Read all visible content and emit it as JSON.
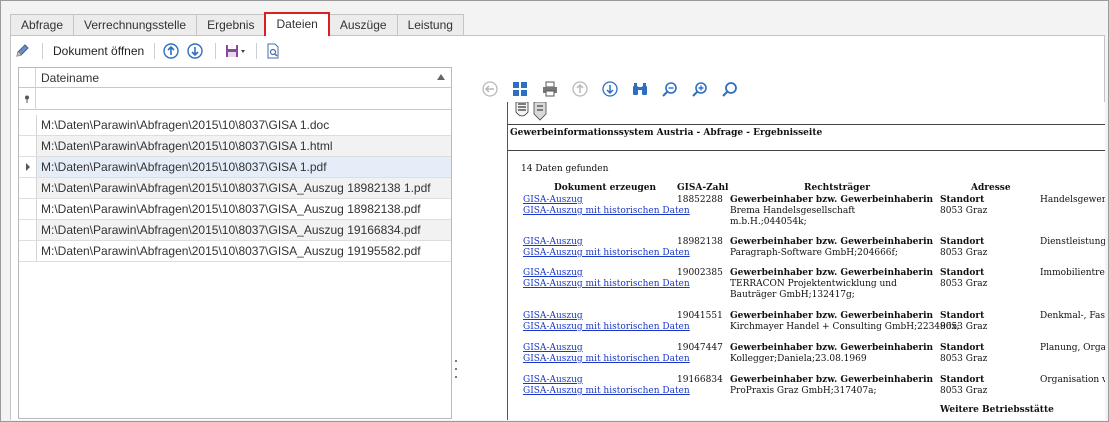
{
  "tabs": [
    {
      "label": "Abfrage"
    },
    {
      "label": "Verrechnungsstelle"
    },
    {
      "label": "Ergebnis"
    },
    {
      "label": "Dateien",
      "active": true
    },
    {
      "label": "Auszüge"
    },
    {
      "label": "Leistung"
    }
  ],
  "toolbar": {
    "edit_icon": "pencil-icon",
    "open_label": "Dokument öffnen",
    "up_icon": "arrow-up-circle-icon",
    "down_icon": "arrow-down-circle-icon",
    "save_icon": "save-dropdown-icon",
    "preview_icon": "page-search-icon"
  },
  "grid": {
    "column_header": "Dateiname",
    "filter_icon": "filter-pin-icon",
    "selected_index": 2,
    "rows": [
      "M:\\Daten\\Parawin\\Abfragen\\2015\\10\\8037\\GISA 1.doc",
      "M:\\Daten\\Parawin\\Abfragen\\2015\\10\\8037\\GISA 1.html",
      "M:\\Daten\\Parawin\\Abfragen\\2015\\10\\8037\\GISA 1.pdf",
      "M:\\Daten\\Parawin\\Abfragen\\2015\\10\\8037\\GISA_Auszug 18982138 1.pdf",
      "M:\\Daten\\Parawin\\Abfragen\\2015\\10\\8037\\GISA_Auszug 18982138.pdf",
      "M:\\Daten\\Parawin\\Abfragen\\2015\\10\\8037\\GISA_Auszug 19166834.pdf",
      "M:\\Daten\\Parawin\\Abfragen\\2015\\10\\8037\\GISA_Auszug 19195582.pdf"
    ]
  },
  "viewer_toolbar": [
    "back-circle-icon",
    "windows-icon",
    "printer-icon",
    "arrow-up-circle-icon",
    "arrow-down-circle-icon",
    "binoculars-icon",
    "zoom-out-icon",
    "zoom-in-icon",
    "search-icon"
  ],
  "document": {
    "title": "Gewerbeinformationssystem Austria - Abfrage - Ergebnisseite",
    "found": "14 Daten gefunden",
    "headers": {
      "doc": "Dokument erzeugen",
      "gisa": "GISA-Zahl",
      "rechtstraeger": "Rechtsträger",
      "adresse": "Adresse"
    },
    "link1": "GISA-Auszug",
    "link2": "GISA-Auszug mit historischen Daten",
    "entries": [
      {
        "gisa": "18852288",
        "role": "Gewerbeinhaber bzw. Gewerbeinhaberin",
        "name": [
          "Brema Handelsgesellschaft",
          "m.b.H.;044054k;"
        ],
        "addr1": "Standort",
        "addr2": "8053 Graz",
        "extra": "Handelsgewerbe"
      },
      {
        "gisa": "18982138",
        "role": "Gewerbeinhaber bzw. Gewerbeinhaberin",
        "name": [
          "Paragraph-Software GmbH;204666f;"
        ],
        "addr1": "Standort",
        "addr2": "8053 Graz",
        "extra": "Dienstleistungen"
      },
      {
        "gisa": "19002385",
        "role": "Gewerbeinhaber bzw. Gewerbeinhaberin",
        "name": [
          "TERRACON Projektentwicklung und",
          "Bauträger GmbH;132417g;"
        ],
        "addr1": "Standort",
        "addr2": "8053 Graz",
        "extra": "Immobilientreuh"
      },
      {
        "gisa": "19041551",
        "role": "Gewerbeinhaber bzw. Gewerbeinhaberin",
        "name": [
          "Kirchmayer Handel + Consulting GmbH;223496x;"
        ],
        "addr1": "Standort",
        "addr2": "8053 Graz",
        "extra": "Denkmal-, Fassa"
      },
      {
        "gisa": "19047447",
        "role": "Gewerbeinhaber bzw. Gewerbeinhaberin",
        "name": [
          "Kollegger;Daniela;23.08.1969"
        ],
        "addr1": "Standort",
        "addr2": "8053 Graz",
        "extra": "Planung, Organ"
      },
      {
        "gisa": "19166834",
        "role": "Gewerbeinhaber bzw. Gewerbeinhaberin",
        "name": [
          "ProPraxis Graz GmbH;317407a;"
        ],
        "addr1": "Standort",
        "addr2": "8053 Graz",
        "extra": "Organisation vo"
      }
    ],
    "weitere": "Weitere Betriebsstätte"
  }
}
